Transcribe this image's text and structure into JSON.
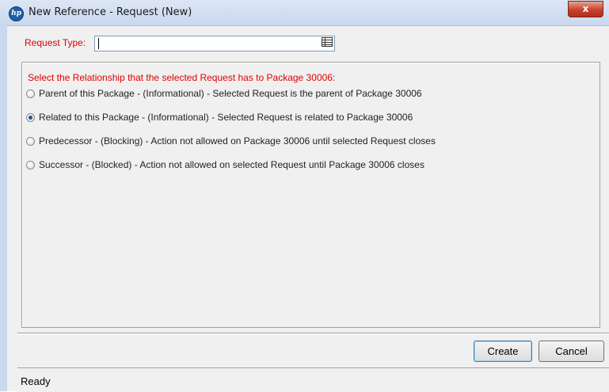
{
  "window": {
    "title": "New Reference - Request (New)",
    "app_icon": "hp-icon",
    "close_label": "x"
  },
  "request_type": {
    "label": "Request Type:",
    "value": "",
    "lookup_icon": "lookup-list-icon"
  },
  "relationship": {
    "prompt": "Select the Relationship that the selected Request has to Package 30006:",
    "options": [
      {
        "label": "Parent of this Package - (Informational) - Selected Request is the parent of Package 30006",
        "selected": false
      },
      {
        "label": "Related to this Package - (Informational) - Selected Request is related to Package 30006",
        "selected": true
      },
      {
        "label": "Predecessor - (Blocking) - Action not allowed on Package 30006 until selected Request closes",
        "selected": false
      },
      {
        "label": "Successor - (Blocked) - Action not allowed on selected Request until Package 30006 closes",
        "selected": false
      }
    ]
  },
  "buttons": {
    "create": "Create",
    "cancel": "Cancel"
  },
  "status": {
    "text": "Ready"
  },
  "colors": {
    "required_label": "#e00000",
    "titlebar": "#c9d8ee",
    "close_button": "#c8412b"
  }
}
